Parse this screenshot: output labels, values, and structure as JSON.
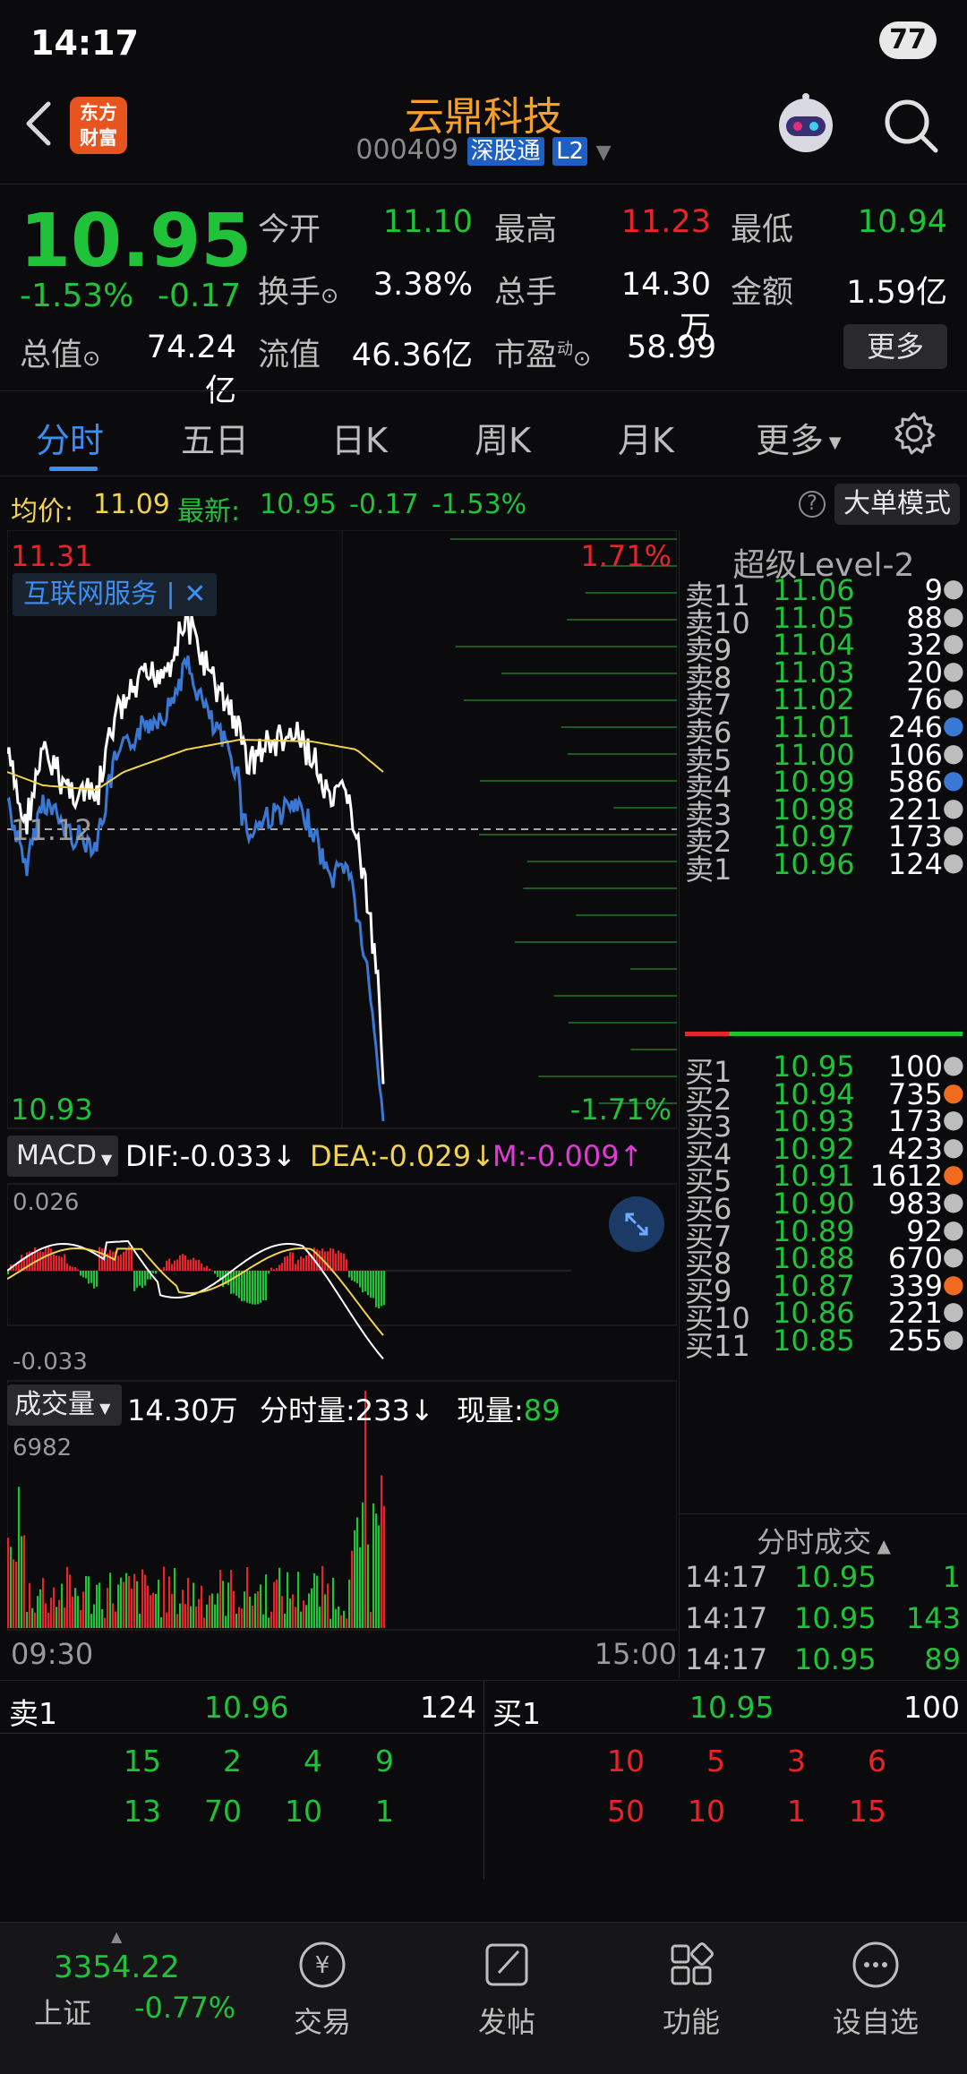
{
  "status": {
    "time": "14:17",
    "battery": "77"
  },
  "header": {
    "name": "云鼎科技",
    "code": "000409",
    "tag1": "深股通",
    "tag2": "L2",
    "logo_top": "东方",
    "logo_bottom": "财富"
  },
  "quote": {
    "price": "10.95",
    "pct": "-1.53%",
    "chg": "-0.17",
    "open_label": "今开",
    "open": "11.10",
    "high_label": "最高",
    "high": "11.23",
    "low_label": "最低",
    "low": "10.94",
    "turnover_label": "换手",
    "turnover": "3.38%",
    "volume_label": "总手",
    "volume": "14.30万",
    "amount_label": "金额",
    "amount": "1.59亿",
    "mcap_label": "总值",
    "mcap": "74.24亿",
    "float_label": "流值",
    "float": "46.36亿",
    "pe_label": "市盈",
    "pe_sup": "动",
    "pe": "58.99",
    "more": "更多"
  },
  "tabs": [
    "分时",
    "五日",
    "日K",
    "周K",
    "月K",
    "更多"
  ],
  "avgline": {
    "avg_label": "均价:",
    "avg": "11.09",
    "last_label": "最新:",
    "last": "10.95",
    "chg": "-0.17",
    "pct": "-1.53%",
    "big_order": "大单模式"
  },
  "chart": {
    "top_price": "11.31",
    "top_pct": "1.71%",
    "mid_price": "11.12",
    "bottom_price": "10.93",
    "bottom_pct": "-1.71%",
    "topic_tag": "互联网服务",
    "macd_label": "MACD",
    "dif": "DIF:-0.033",
    "dea": "DEA:-0.029",
    "m": "M:-0.009",
    "macd_top": "0.026",
    "macd_bottom": "-0.033",
    "vol_label": "成交量",
    "vol_total": "14.30万",
    "vol_min_label": "分时量:233",
    "vol_now_label": "现量:",
    "vol_now": "89",
    "vol_max": "6982",
    "time_start": "09:30",
    "time_end": "15:00"
  },
  "level2": {
    "title": "超级Level-2",
    "asks": [
      {
        "label": "卖11",
        "price": "11.06",
        "vol": "9",
        "dot": "gray"
      },
      {
        "label": "卖10",
        "price": "11.05",
        "vol": "88",
        "dot": "gray"
      },
      {
        "label": "卖9",
        "price": "11.04",
        "vol": "32",
        "dot": "gray"
      },
      {
        "label": "卖8",
        "price": "11.03",
        "vol": "20",
        "dot": "gray"
      },
      {
        "label": "卖7",
        "price": "11.02",
        "vol": "76",
        "dot": "gray"
      },
      {
        "label": "卖6",
        "price": "11.01",
        "vol": "246",
        "dot": "blue"
      },
      {
        "label": "卖5",
        "price": "11.00",
        "vol": "106",
        "dot": "gray"
      },
      {
        "label": "卖4",
        "price": "10.99",
        "vol": "586",
        "dot": "blue"
      },
      {
        "label": "卖3",
        "price": "10.98",
        "vol": "221",
        "dot": "gray"
      },
      {
        "label": "卖2",
        "price": "10.97",
        "vol": "173",
        "dot": "gray"
      },
      {
        "label": "卖1",
        "price": "10.96",
        "vol": "124",
        "dot": "gray"
      }
    ],
    "bids": [
      {
        "label": "买1",
        "price": "10.95",
        "vol": "100",
        "dot": "gray"
      },
      {
        "label": "买2",
        "price": "10.94",
        "vol": "735",
        "dot": "orange"
      },
      {
        "label": "买3",
        "price": "10.93",
        "vol": "173",
        "dot": "gray"
      },
      {
        "label": "买4",
        "price": "10.92",
        "vol": "423",
        "dot": "gray"
      },
      {
        "label": "买5",
        "price": "10.91",
        "vol": "1612",
        "dot": "orange"
      },
      {
        "label": "买6",
        "price": "10.90",
        "vol": "983",
        "dot": "gray"
      },
      {
        "label": "买7",
        "price": "10.89",
        "vol": "92",
        "dot": "gray"
      },
      {
        "label": "买8",
        "price": "10.88",
        "vol": "670",
        "dot": "gray"
      },
      {
        "label": "买9",
        "price": "10.87",
        "vol": "339",
        "dot": "orange"
      },
      {
        "label": "买10",
        "price": "10.86",
        "vol": "221",
        "dot": "gray"
      },
      {
        "label": "买11",
        "price": "10.85",
        "vol": "255",
        "dot": "gray"
      }
    ],
    "ticks_title": "分时成交",
    "ticks": [
      {
        "time": "14:17",
        "price": "10.95",
        "vol": "1"
      },
      {
        "time": "14:17",
        "price": "10.95",
        "vol": "143"
      },
      {
        "time": "14:17",
        "price": "10.95",
        "vol": "89"
      }
    ]
  },
  "bottom_book": {
    "sell_label": "卖1",
    "sell_price": "10.96",
    "sell_vol": "124",
    "buy_label": "买1",
    "buy_price": "10.95",
    "buy_vol": "100",
    "sell_q1": [
      "15",
      "2",
      "4",
      "9"
    ],
    "sell_q2": [
      "13",
      "70",
      "10",
      "1"
    ],
    "buy_q1": [
      "10",
      "5",
      "3",
      "6"
    ],
    "buy_q2": [
      "50",
      "10",
      "1",
      "15"
    ]
  },
  "nav": {
    "index_value": "3354.22",
    "index_name": "上证",
    "index_pct": "-0.77%",
    "items": [
      "交易",
      "发帖",
      "功能",
      "设自选"
    ]
  },
  "colors": {
    "up": "#e8232b",
    "down": "#20c23a",
    "accent": "#3d8ef2",
    "brand": "#f6a02a"
  }
}
